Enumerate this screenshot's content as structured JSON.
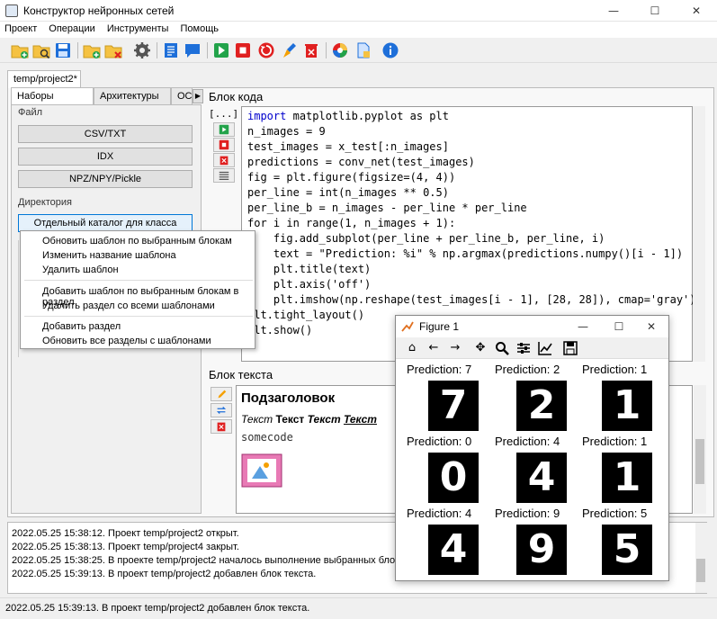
{
  "window": {
    "title": "Конструктор нейронных сетей",
    "minimize": "—",
    "maximize": "☐",
    "close": "✕"
  },
  "menu": [
    "Проект",
    "Операции",
    "Инструменты",
    "Помощь"
  ],
  "project_tab": "temp/project2*",
  "left": {
    "tabs": [
      "Наборы данных",
      "Архитектуры",
      "ОС"
    ],
    "file_group": "Файл",
    "file_buttons": [
      "CSV/TXT",
      "IDX",
      "NPZ/NPY/Pickle"
    ],
    "dir_group": "Директория",
    "dir_button": "Отдельный каталог для класса"
  },
  "context_menu": {
    "item1": "Обновить шаблон по выбранным блокам",
    "item2": "Изменить название шаблона",
    "item3": "Удалить шаблон",
    "item4": "Добавить шаблон по выбранным блокам в раздел",
    "item5": "Удалить раздел со всеми шаблонами",
    "item6": "Добавить раздел",
    "item7": "Обновить все разделы с шаблонами"
  },
  "code_block": {
    "label": "Блок кода",
    "gutter_label": "[...]",
    "lines": [
      "import matplotlib.pyplot as plt",
      "n_images = 9",
      "test_images = x_test[:n_images]",
      "predictions = conv_net(test_images)",
      "fig = plt.figure(figsize=(4, 4))",
      "per_line = int(n_images ** 0.5)",
      "per_line_b = n_images - per_line * per_line",
      "for i in range(1, n_images + 1):",
      "    fig.add_subplot(per_line + per_line_b, per_line, i)",
      "    text = \"Prediction: %i\" % np.argmax(predictions.numpy()[i - 1])",
      "    plt.title(text)",
      "    plt.axis('off')",
      "    plt.imshow(np.reshape(test_images[i - 1], [28, 28]), cmap='gray')",
      "plt.tight_layout()",
      "plt.show()"
    ]
  },
  "text_block": {
    "label": "Блок текста",
    "heading": "Подзаголовок",
    "italic": "Текст",
    "bold": "Текст",
    "bold_italic": "Текст",
    "bold_italic_underline": "Текст",
    "code": "somecode"
  },
  "figure": {
    "title": "Figure 1",
    "predictions": [
      {
        "label": "Prediction: 7",
        "digit": "7"
      },
      {
        "label": "Prediction: 2",
        "digit": "2"
      },
      {
        "label": "Prediction: 1",
        "digit": "1"
      },
      {
        "label": "Prediction: 0",
        "digit": "0"
      },
      {
        "label": "Prediction: 4",
        "digit": "4"
      },
      {
        "label": "Prediction: 1",
        "digit": "1"
      },
      {
        "label": "Prediction: 4",
        "digit": "4"
      },
      {
        "label": "Prediction: 9",
        "digit": "9"
      },
      {
        "label": "Prediction: 5",
        "digit": "5"
      }
    ]
  },
  "log": {
    "l1": "2022.05.25 15:38:12. Проект temp/project2 открыт.",
    "l2": "2022.05.25 15:38:13. Проект temp/project4 закрыт.",
    "l3": "2022.05.25 15:38:25. В проекте temp/project2 началось выполнение выбранных блоков.",
    "l4": "2022.05.25 15:39:13. В проект temp/project2 добавлен блок текста."
  },
  "status": "2022.05.25 15:39:13. В проект temp/project2 добавлен блок текста.",
  "colors": {
    "accent": "#0078d7",
    "green": "#22a34a",
    "red": "#e02020",
    "folder": "#f5c242"
  }
}
